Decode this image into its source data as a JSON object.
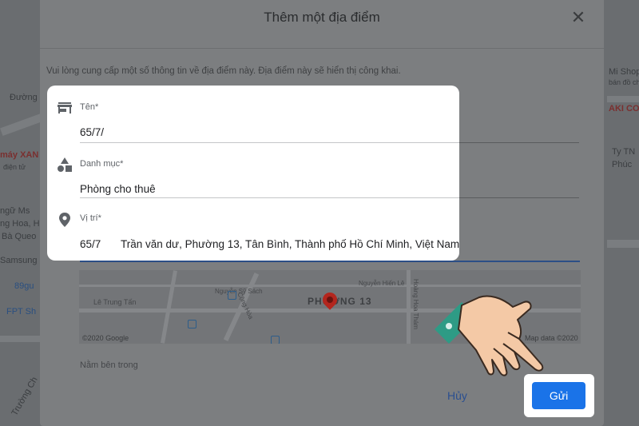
{
  "dialog": {
    "title": "Thêm một địa điểm",
    "intro": "Vui lòng cung cấp một số thông tin về địa điểm này. Địa điểm này sẽ hiển thị công khai.",
    "close_icon": "close-icon"
  },
  "fields": {
    "name": {
      "label": "Tên*",
      "value": "65/7/",
      "icon": "store-icon"
    },
    "category": {
      "label": "Danh mục*",
      "value": "Phòng cho thuê",
      "icon": "category-shapes-icon"
    },
    "location": {
      "label": "Vị trí*",
      "value_prefix": "65/7",
      "value_rest": "Trần văn dư, Phường 13, Tân Bình, Thành phố Hồ Chí Minh, Việt Nam",
      "icon": "location-pin-icon"
    }
  },
  "map_preview": {
    "area_label": "PHƯỜNG 13",
    "copyright_left": "©2020 Google",
    "copyright_right": "Map data ©2020",
    "streets": [
      "Trường Chinh",
      "Lê Trung Tấn",
      "Cộng Hòa",
      "Nguyễn Hiến Lê",
      "Hoàng Hoa Thám",
      "Nguyễn Sỹ Sách"
    ]
  },
  "partial_section": "Nằm bên trong",
  "buttons": {
    "cancel": "Hủy",
    "submit": "Gửi"
  },
  "background_labels": {
    "left": [
      "Đường D",
      "máy XAN",
      "điện tử",
      "ngữ Ms",
      "ng Hoa, H",
      "Bà Queo",
      "Samsung",
      "89gu",
      "FPT Sh",
      "Trường Ch"
    ],
    "right": [
      "Mi Shop",
      "bán đồ chơi",
      "AKI CO",
      "Ty TN",
      "Phúc"
    ]
  },
  "colors": {
    "submit_bg": "#1a73e8",
    "location_underline": "#2c4f86",
    "pin": "#b3261e"
  }
}
